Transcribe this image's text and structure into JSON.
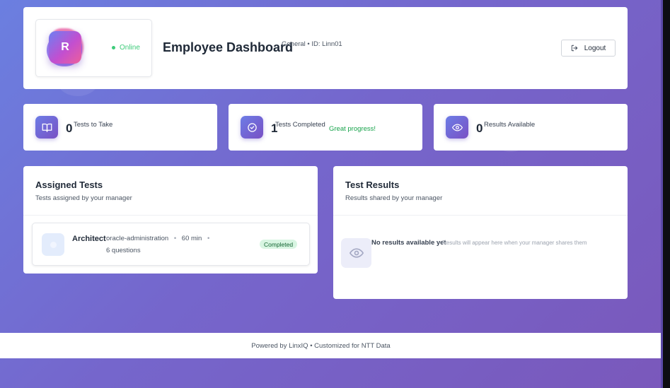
{
  "header": {
    "avatar_initial": "R",
    "status": "Online",
    "title": "Employee Dashboard",
    "meta": "General • ID: Linn01",
    "logout_label": "Logout"
  },
  "stats": [
    {
      "value": "0",
      "label": "Tests to Take",
      "icon": "book-open-icon"
    },
    {
      "value": "1",
      "label": "Tests Completed",
      "extra": "Great progress!",
      "icon": "check-circle-icon"
    },
    {
      "value": "0",
      "label": "Results Available",
      "icon": "eye-icon"
    }
  ],
  "assigned": {
    "title": "Assigned Tests",
    "subtitle": "Tests assigned by your manager",
    "items": [
      {
        "name": "Architect",
        "category": "oracle-administration",
        "duration": "60 min",
        "questions": "6 questions",
        "status": "Completed"
      }
    ]
  },
  "results": {
    "title": "Test Results",
    "subtitle": "Results shared by your manager",
    "empty_title": "No results available yet",
    "empty_sub": "Results will appear here when your manager shares them"
  },
  "footer": {
    "text": "Powered by LinxIQ • Customized for NTT Data"
  },
  "colors": {
    "accent_start": "#6c7de6",
    "accent_end": "#7950c4",
    "success": "#16a34a",
    "online": "#3ecb7a"
  }
}
